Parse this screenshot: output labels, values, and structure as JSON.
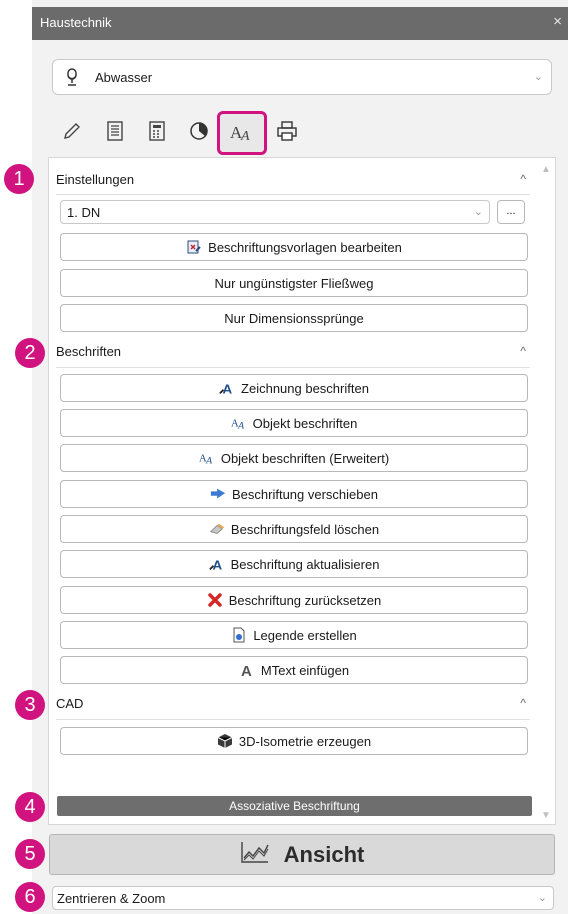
{
  "window": {
    "title": "Haustechnik",
    "close_glyph": "×"
  },
  "system_dropdown": {
    "value": "Abwasser",
    "icon": "water-drop-icon"
  },
  "tabs": [
    {
      "icon": "pencil-icon"
    },
    {
      "icon": "list-icon"
    },
    {
      "icon": "calculator-icon"
    },
    {
      "icon": "pie-chart-icon"
    },
    {
      "icon": "text-label-icon",
      "active": true
    },
    {
      "icon": "printer-icon"
    }
  ],
  "sections": {
    "einstellungen": {
      "marker": "1",
      "title": "Einstellungen",
      "caret": "^",
      "dn_select": {
        "value": "1. DN"
      },
      "more_button": "...",
      "buttons": [
        "Beschriftungsvorlagen bearbeiten",
        "Nur ungünstigster Fließweg",
        "Nur Dimensionssprünge"
      ]
    },
    "beschriften": {
      "marker": "2",
      "title": "Beschriften",
      "caret": "^",
      "buttons": [
        "Zeichnung beschriften",
        "Objekt beschriften",
        "Objekt beschriften (Erweitert)",
        "Beschriftung verschieben",
        "Beschriftungsfeld löschen",
        "Beschriftung aktualisieren",
        "Beschriftung zurücksetzen",
        "Legende erstellen",
        "MText einfügen"
      ]
    },
    "cad": {
      "marker": "3",
      "title": "CAD",
      "caret": "^",
      "buttons": [
        "3D-Isometrie erzeugen"
      ]
    }
  },
  "assoc_bar": {
    "marker": "4",
    "label": "Assoziative Beschriftung"
  },
  "ansicht": {
    "marker": "5",
    "label": "Ansicht"
  },
  "zoom_dropdown": {
    "marker": "6",
    "value": "Zentrieren & Zoom"
  },
  "colors": {
    "accent": "#d0137f",
    "titlebar": "#6b6b6b",
    "bar": "#6e6e6e"
  }
}
